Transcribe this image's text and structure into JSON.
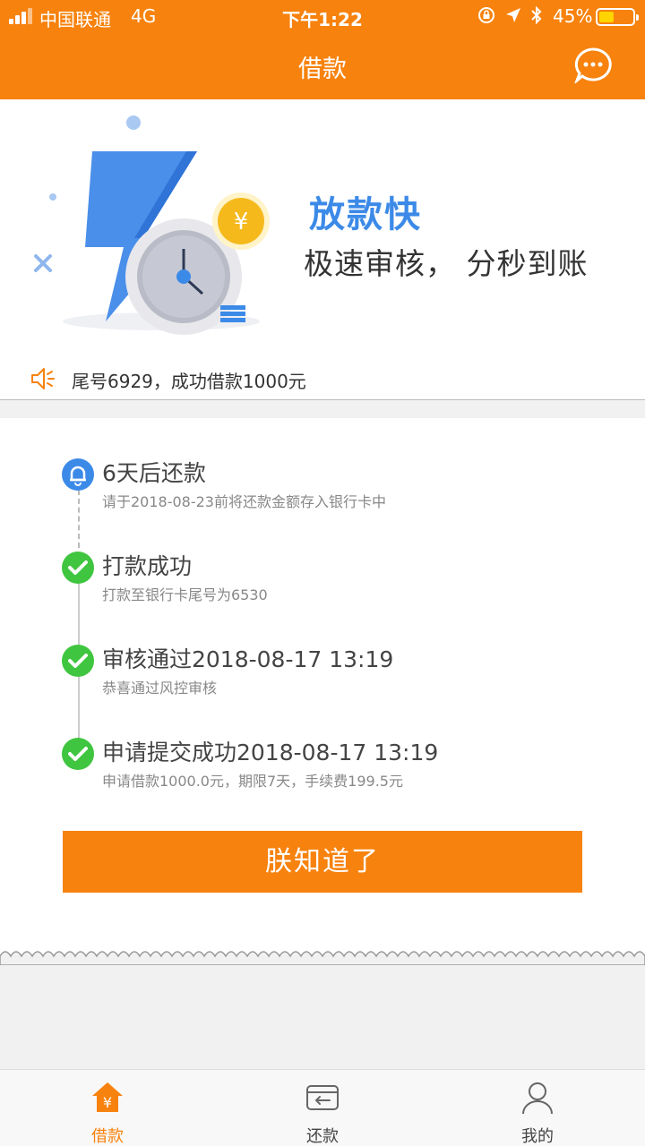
{
  "status": {
    "carrier": "中国联通",
    "network": "4G",
    "time": "下午1:22",
    "battery": "45%",
    "battery_level": 0.45
  },
  "header": {
    "title": "借款"
  },
  "banner": {
    "slogan_main": "放款快",
    "slogan_sub": "极速审核， 分秒到账",
    "coin_symbol": "¥"
  },
  "notice": {
    "text": "尾号6929，成功借款1000元"
  },
  "timeline": [
    {
      "title": "6天后还款",
      "desc": "请于2018-08-23前将还款金额存入银行卡中",
      "icon": "bell-icon"
    },
    {
      "title": "打款成功",
      "desc": "打款至银行卡尾号为6530",
      "icon": "check-icon"
    },
    {
      "title": "审核通过2018-08-17 13:19",
      "desc": "恭喜通过风控审核",
      "icon": "check-icon"
    },
    {
      "title": "申请提交成功2018-08-17 13:19",
      "desc": "申请借款1000.0元，期限7天，手续费199.5元",
      "icon": "check-icon"
    }
  ],
  "actions": {
    "confirm_label": "朕知道了"
  },
  "tabs": [
    {
      "label": "借款",
      "icon": "loan-icon",
      "active": true
    },
    {
      "label": "还款",
      "icon": "repay-icon",
      "active": false
    },
    {
      "label": "我的",
      "icon": "user-icon",
      "active": false
    }
  ],
  "colors": {
    "brand": "#f7820d",
    "accent_blue": "#3c8ae8",
    "success_green": "#3fc53f"
  }
}
